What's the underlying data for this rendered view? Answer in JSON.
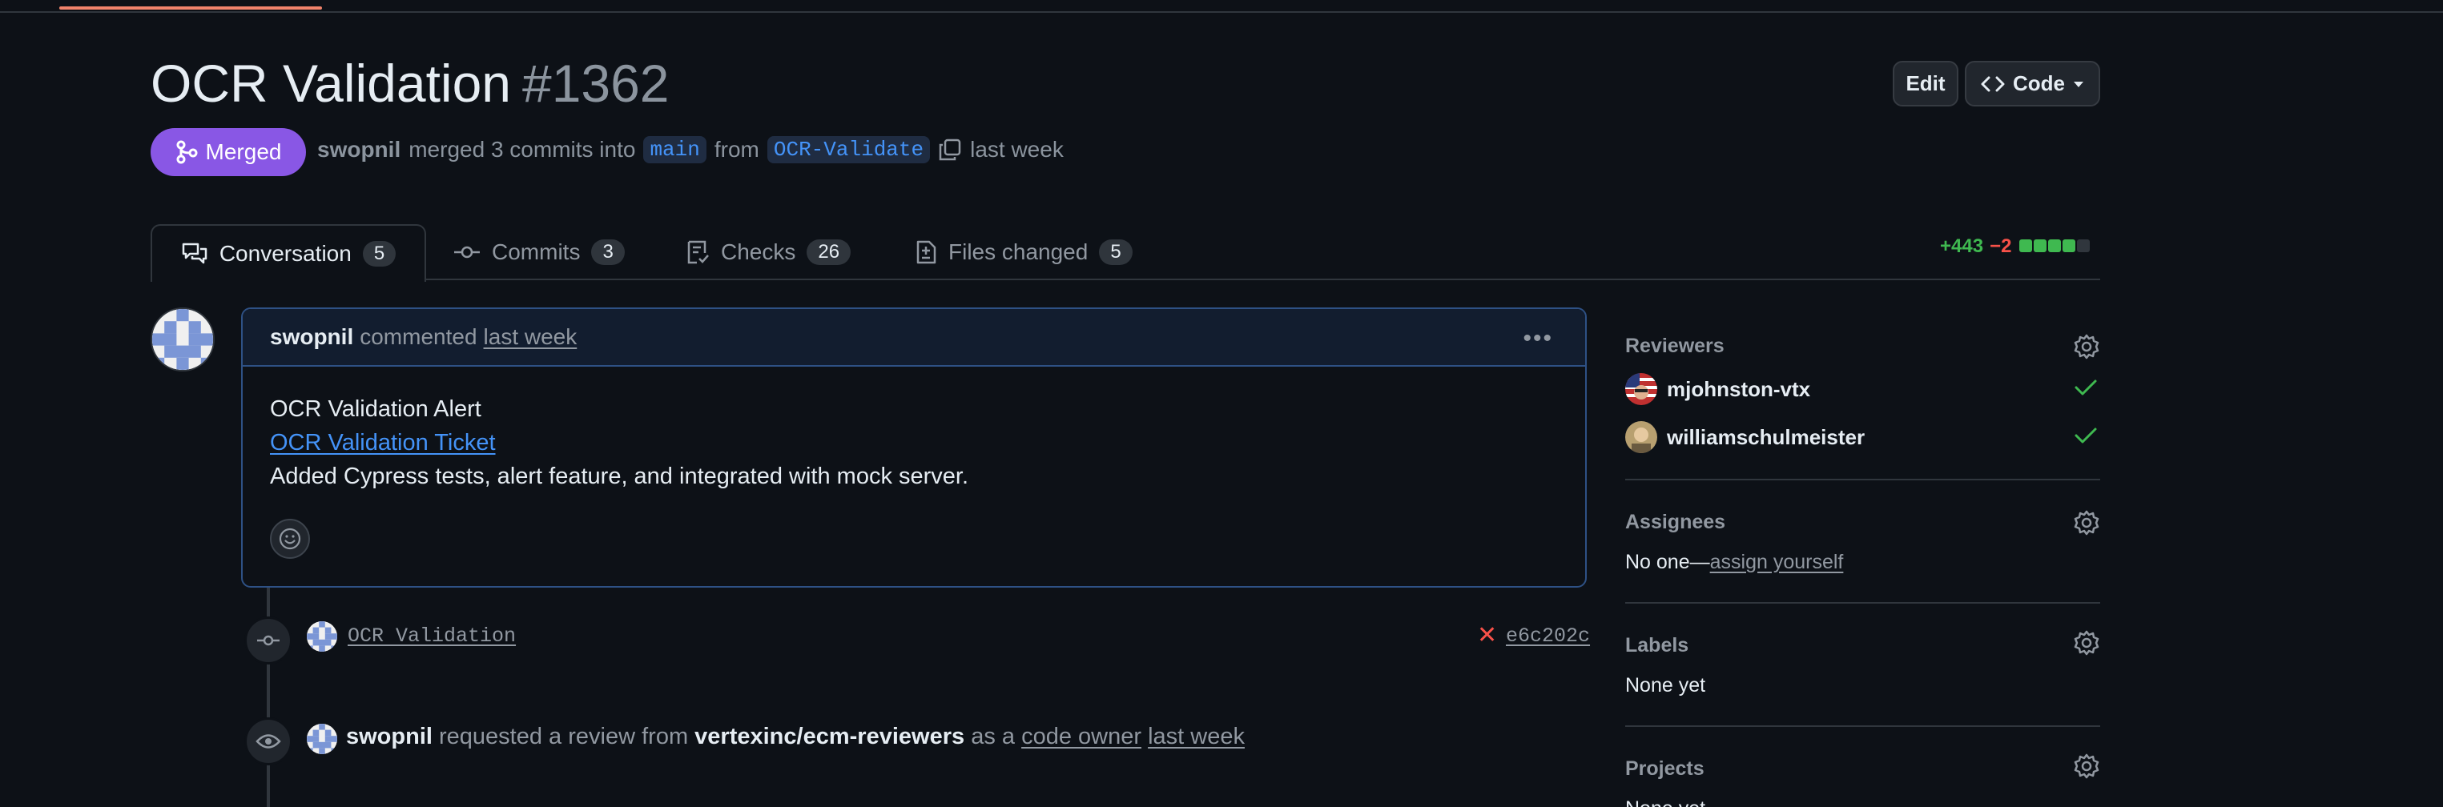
{
  "pr": {
    "title": "OCR Validation",
    "number": "#1362",
    "state": "Merged",
    "author": "swopnil",
    "merge_text": "merged 3 commits into",
    "base_branch": "main",
    "from_text": "from",
    "head_branch": "OCR-Validate",
    "time": "last week"
  },
  "header_buttons": {
    "edit": "Edit",
    "code": "Code"
  },
  "tabs": [
    {
      "label": "Conversation",
      "count": "5",
      "icon": "comment-discussion-icon"
    },
    {
      "label": "Commits",
      "count": "3",
      "icon": "git-commit-icon"
    },
    {
      "label": "Checks",
      "count": "26",
      "icon": "checklist-icon"
    },
    {
      "label": "Files changed",
      "count": "5",
      "icon": "file-diff-icon"
    }
  ],
  "diffstat": {
    "additions": "+443",
    "deletions": "−2",
    "colors": {
      "add": "#3fb950",
      "del": "#f85149",
      "neutral": "#30363d"
    }
  },
  "comment": {
    "author": "swopnil",
    "action": "commented",
    "time": "last week",
    "line1": "OCR Validation Alert",
    "link": "OCR Validation Ticket",
    "line3": "Added Cypress tests, alert feature, and integrated with mock server."
  },
  "timeline": {
    "commit": {
      "message": "OCR Validation",
      "status": "✕",
      "sha": "e6c202c"
    },
    "review_request": {
      "user": "swopnil",
      "text1": "requested a review from",
      "team": "vertexinc/ecm-reviewers",
      "text2": "as a",
      "role": "code owner",
      "time": "last week"
    }
  },
  "sidebar": {
    "reviewers": {
      "label": "Reviewers",
      "items": [
        {
          "name": "mjohnston-vtx"
        },
        {
          "name": "williamschulmeister"
        }
      ]
    },
    "assignees": {
      "label": "Assignees",
      "none_text": "No one—",
      "assign_link": "assign yourself"
    },
    "labels": {
      "label": "Labels",
      "value": "None yet"
    },
    "projects": {
      "label": "Projects",
      "value": "None yet"
    }
  },
  "colors": {
    "background": "#0d1117",
    "merged": "#8957e5",
    "link": "#4493f8",
    "border": "#30363d"
  }
}
